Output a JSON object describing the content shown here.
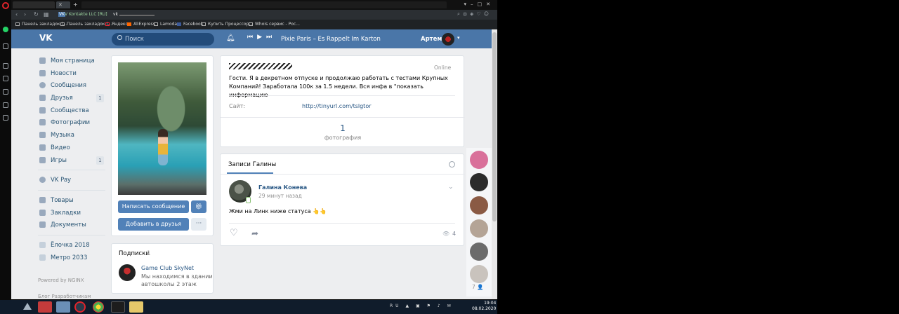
{
  "browser": {
    "tab_badge": "VK",
    "active_tab_title": "V Kontakte LLC [RU]",
    "url_prefix": "vk",
    "bookmarks": [
      {
        "label": "Панель закладок (..."
      },
      {
        "label": "Панель закладок (..."
      },
      {
        "label": "Яндекс"
      },
      {
        "label": "AliExpress"
      },
      {
        "label": "Lamoda"
      },
      {
        "label": "Facebook"
      },
      {
        "label": "Купить Процессор..."
      },
      {
        "label": "Whois сервис - Рос..."
      }
    ]
  },
  "header": {
    "search_placeholder": "Поиск",
    "track": "Pixie Paris – Es Rappelt Im Karton",
    "user_name": "Артем"
  },
  "leftnav": {
    "items": [
      {
        "label": "Моя страница"
      },
      {
        "label": "Новости"
      },
      {
        "label": "Сообщения"
      },
      {
        "label": "Друзья",
        "count": "1"
      },
      {
        "label": "Сообщества"
      },
      {
        "label": "Фотографии"
      },
      {
        "label": "Музыка"
      },
      {
        "label": "Видео"
      },
      {
        "label": "Игры",
        "count": "1"
      }
    ],
    "vkpay": "VK Pay",
    "extra": [
      {
        "label": "Товары"
      },
      {
        "label": "Закладки"
      },
      {
        "label": "Документы"
      }
    ],
    "apps": [
      {
        "label": "Ёлочка 2018"
      },
      {
        "label": "Метро 2033"
      }
    ],
    "powered": "Powered by NGINX",
    "footer": "Блог   Разработчикам"
  },
  "profile": {
    "write_button": "Написать сообщение",
    "add_friend_button": "Добавить в друзья",
    "more_button": "···",
    "status": "Гости. Я в декретном отпуске и продолжаю работать с тестами Крупных Компаний! Заработала 100к за 1.5 недели. Вся инфа в \"показать информацию",
    "online": "Online",
    "site_label": "Сайт:",
    "site_link": "http://tinyurl.com/tslgtor",
    "photos_count": "1",
    "photos_label": "фотография"
  },
  "subscriptions": {
    "title": "Подписки",
    "count": "1",
    "item_name": "Game Club SkyNet",
    "item_desc_line1": "Мы находимся в здании",
    "item_desc_line2": "автошколы 2 этаж"
  },
  "wall": {
    "tab_label": "Записи Галины",
    "post": {
      "author": "Галина Конева",
      "time": "29 минут назад",
      "text": "Жми на Линк ниже статуса 👆👆",
      "views": "4"
    }
  },
  "friends_rail": {
    "more_count": "7 👤",
    "avatar_colors": [
      "#d9709a",
      "#2b2b2b",
      "#8a5a44",
      "#b4a496",
      "#6b6b6b",
      "#c9c3bd"
    ]
  },
  "taskbar": {
    "lang": "RU",
    "time": "19:04",
    "date": "08.02.2020"
  },
  "colors": {
    "vk_blue": "#4a76a8",
    "button_blue": "#5181b8",
    "link": "#2a5885",
    "page_bg": "#edeef0"
  }
}
